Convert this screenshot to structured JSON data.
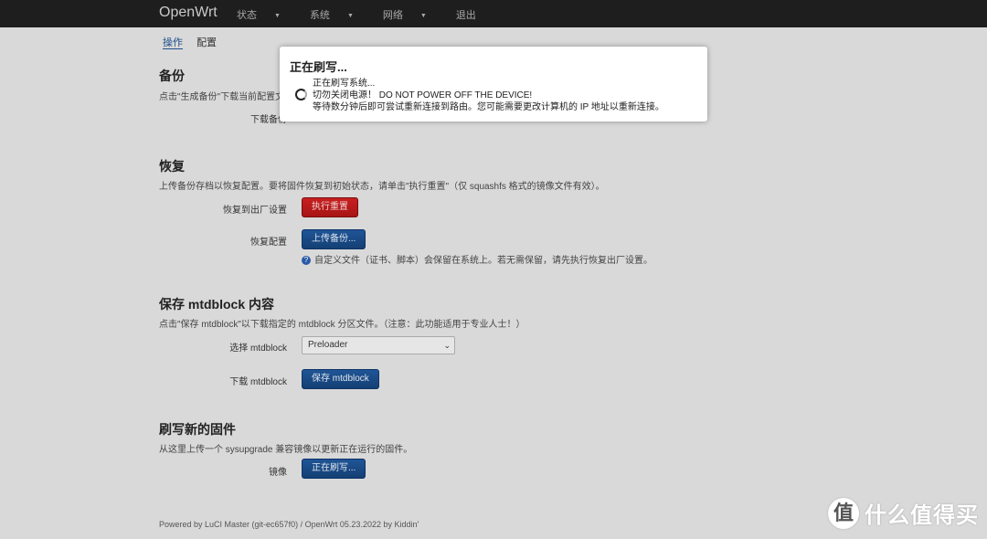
{
  "navbar": {
    "brand": "OpenWrt",
    "menu": [
      "状态",
      "系统",
      "网络",
      "退出"
    ]
  },
  "subtabs": [
    "操作",
    "配置"
  ],
  "backup": {
    "title": "备份",
    "desc": "点击\"生成备份\"下载当前配置文",
    "download_label": "下载备份"
  },
  "restore": {
    "title": "恢复",
    "desc": "上传备份存档以恢复配置。要将固件恢复到初始状态，请单击\"执行重置\"（仅 squashfs 格式的镜像文件有效）。",
    "factory_label": "恢复到出厂设置",
    "factory_button": "执行重置",
    "restore_label": "恢复配置",
    "upload_button": "上传备份...",
    "hint": "自定义文件（证书、脚本）会保留在系统上。若无需保留，请先执行恢复出厂设置。"
  },
  "mtd": {
    "title": "保存 mtdblock 内容",
    "desc": "点击\"保存 mtdblock\"以下载指定的 mtdblock 分区文件。（注意：此功能适用于专业人士！）",
    "select_label": "选择 mtdblock",
    "selected": "Preloader",
    "download_label": "下载 mtdblock",
    "save_button": "保存 mtdblock"
  },
  "flash": {
    "title": "刷写新的固件",
    "desc": "从这里上传一个 sysupgrade 兼容镜像以更新正在运行的固件。",
    "image_label": "镜像",
    "flash_button": "正在刷写..."
  },
  "footer": "Powered by LuCI Master (git-ec657f0) / OpenWrt 05.23.2022 by Kiddin'",
  "modal": {
    "title": "正在刷写...",
    "line1": "正在刷写系统...",
    "line2": "切勿关闭电源！ DO NOT POWER OFF THE DEVICE!",
    "line3": "等待数分钟后即可尝试重新连接到路由。您可能需要更改计算机的 IP 地址以重新连接。"
  },
  "watermark": {
    "icon": "值",
    "text": "什么值得买"
  }
}
